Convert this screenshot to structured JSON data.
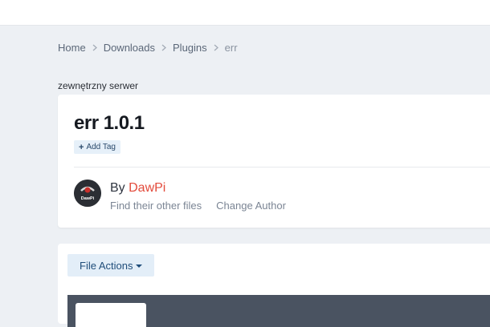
{
  "breadcrumb": {
    "items": [
      "Home",
      "Downloads",
      "Plugins"
    ],
    "current": "err"
  },
  "note": "zewnętrzny serwer",
  "file": {
    "title": "err 1.0.1",
    "add_tag_label": "Add Tag"
  },
  "author": {
    "by_prefix": "By",
    "name": "DawPi",
    "avatar_text": "DawPi",
    "find_files_label": "Find their other files",
    "change_author_label": "Change Author"
  },
  "actions": {
    "file_actions_label": "File Actions"
  },
  "colors": {
    "accent": "#e34b3c",
    "link": "#1f4d7a",
    "background": "#edf0f4"
  }
}
